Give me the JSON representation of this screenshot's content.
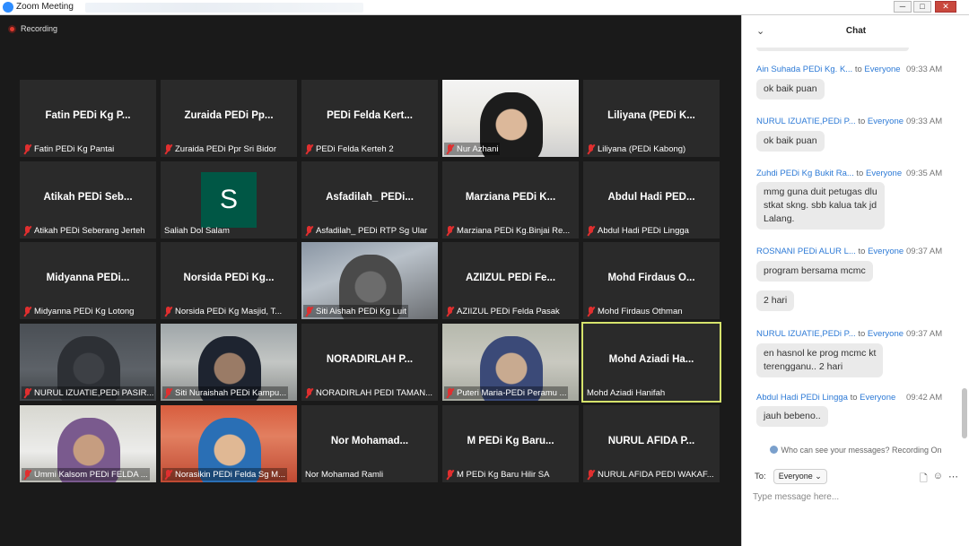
{
  "window": {
    "title": "Zoom Meeting",
    "controls": [
      "─",
      "□",
      "✕"
    ]
  },
  "recording": {
    "label": "Recording"
  },
  "participants": [
    {
      "name": "Fatin PEDi Kg P...",
      "label": "Fatin PEDi Kg Pantai",
      "muted": true,
      "video": false
    },
    {
      "name": "Zuraida PEDi Pp...",
      "label": "Zuraida PEDi Ppr Sri Bidor",
      "muted": true,
      "video": false
    },
    {
      "name": "PEDi  Felda Kert...",
      "label": "PEDi  Felda Kerteh 2",
      "muted": true,
      "video": false
    },
    {
      "name": "",
      "label": "Nur Azhani",
      "muted": true,
      "video": true
    },
    {
      "name": "Liliyana (PEDi K...",
      "label": "Liliyana (PEDi Kabong)",
      "muted": true,
      "video": false
    },
    {
      "name": "Atikah PEDi Seb...",
      "label": "Atikah PEDi Seberang Jerteh",
      "muted": true,
      "video": false
    },
    {
      "name": "",
      "label": "Saliah Dol Salam",
      "muted": false,
      "video": false,
      "avatar": "S"
    },
    {
      "name": "Asfadilah_ PEDi...",
      "label": "Asfadilah_ PEDi RTP Sg Ular",
      "muted": true,
      "video": false
    },
    {
      "name": "Marziana PEDi K...",
      "label": "Marziana PEDi Kg.Binjai Re...",
      "muted": true,
      "video": false
    },
    {
      "name": "Abdul Hadi PED...",
      "label": "Abdul Hadi PEDi Lingga",
      "muted": true,
      "video": false
    },
    {
      "name": "Midyanna  PEDi...",
      "label": "Midyanna PEDi Kg Lotong",
      "muted": true,
      "video": false
    },
    {
      "name": "Norsida PEDi Kg...",
      "label": "Norsida PEDi Kg Masjid, T...",
      "muted": true,
      "video": false
    },
    {
      "name": "",
      "label": "Siti Aishah PEDi Kg Luit",
      "muted": true,
      "video": true
    },
    {
      "name": "AZIIZUL PEDi Fe...",
      "label": "AZIIZUL PEDi Felda Pasak",
      "muted": true,
      "video": false
    },
    {
      "name": "Mohd Firdaus O...",
      "label": "Mohd Firdaus Othman",
      "muted": true,
      "video": false
    },
    {
      "name": "",
      "label": "NURUL IZUATIE,PEDi PASIR...",
      "muted": true,
      "video": true
    },
    {
      "name": "",
      "label": "Siti Nuraishah PEDi Kampu...",
      "muted": true,
      "video": true
    },
    {
      "name": "NORADIRLAH  P...",
      "label": "NORADIRLAH PEDI TAMAN...",
      "muted": true,
      "video": false
    },
    {
      "name": "",
      "label": "Puteri Maria-PEDi Peramu ...",
      "muted": true,
      "video": true
    },
    {
      "name": "Mohd  Aziadi  Ha...",
      "label": "Mohd Aziadi Hanifah",
      "muted": false,
      "video": false,
      "active": true
    },
    {
      "name": "",
      "label": "Ummi Kalsom PEDi FELDA ...",
      "muted": true,
      "video": true
    },
    {
      "name": "",
      "label": "Norasikin PEDi Felda Sg M...",
      "muted": true,
      "video": true
    },
    {
      "name": "Nor  Mohamad...",
      "label": "Nor Mohamad Ramli",
      "muted": false,
      "video": false
    },
    {
      "name": "M PEDi Kg Baru...",
      "label": "M PEDi Kg Baru Hilir SA",
      "muted": true,
      "video": false
    },
    {
      "name": "NURUL AFIDA P...",
      "label": "NURUL AFIDA PEDI WAKAF...",
      "muted": true,
      "video": false
    }
  ],
  "chat": {
    "title": "Chat",
    "to_word": "to",
    "messages": [
      {
        "sender": "Ain Suhada PEDi Kg. K...",
        "to": "Everyone",
        "time": "09:33 AM",
        "lines": [
          "ok baik puan"
        ]
      },
      {
        "sender": "NURUL IZUATIE,PEDi P...",
        "to": "Everyone",
        "time": "09:33 AM",
        "lines": [
          "ok baik puan"
        ]
      },
      {
        "sender": "Zuhdi PEDi Kg Bukit Ra...",
        "to": "Everyone",
        "time": "09:35 AM",
        "lines": [
          "mmg guna duit petugas dlu",
          "stkat skng. sbb kalua tak jd",
          "Lalang."
        ]
      },
      {
        "sender": "ROSNANI PEDi ALUR L...",
        "to": "Everyone",
        "time": "09:37 AM",
        "lines": [
          "program bersama mcmc"
        ],
        "extra": "2 hari"
      },
      {
        "sender": "NURUL IZUATIE,PEDi P...",
        "to": "Everyone",
        "time": "09:37 AM",
        "lines": [
          "en hasnol ke prog mcmc kt",
          "terengganu.. 2 hari"
        ]
      },
      {
        "sender": "Abdul Hadi PEDi Lingga",
        "to": "Everyone",
        "time": "09:42 AM",
        "lines": [
          "jauh bebeno.."
        ]
      }
    ],
    "privacy_note": "Who can see your messages? Recording On",
    "to_label": "To:",
    "recipient": "Everyone",
    "input_placeholder": "Type message here..."
  }
}
